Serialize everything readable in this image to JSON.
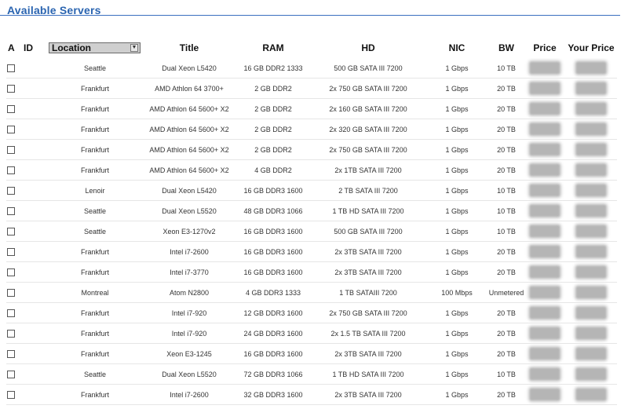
{
  "section": {
    "title": "Available Servers"
  },
  "table": {
    "headers": {
      "a": "A",
      "id": "ID",
      "location": "Location",
      "title": "Title",
      "ram": "RAM",
      "hd": "HD",
      "nic": "NIC",
      "bw": "BW",
      "price": "Price",
      "your_price": "Your Price"
    },
    "location_filter_value": "Location",
    "rows": [
      {
        "id": "",
        "location": "Seattle",
        "title": "Dual Xeon L5420",
        "ram": "16 GB DDR2 1333",
        "hd": "500 GB SATA III 7200",
        "nic": "1 Gbps",
        "bw": "10 TB"
      },
      {
        "id": "",
        "location": "Frankfurt",
        "title": "AMD Athlon 64 3700+",
        "ram": "2 GB DDR2",
        "hd": "2x 750 GB SATA III 7200",
        "nic": "1 Gbps",
        "bw": "20 TB"
      },
      {
        "id": "",
        "location": "Frankfurt",
        "title": "AMD Athlon 64 5600+ X2",
        "ram": "2 GB DDR2",
        "hd": "2x 160 GB SATA III 7200",
        "nic": "1 Gbps",
        "bw": "20 TB"
      },
      {
        "id": "",
        "location": "Frankfurt",
        "title": "AMD Athlon 64 5600+ X2",
        "ram": "2 GB DDR2",
        "hd": "2x 320 GB SATA III 7200",
        "nic": "1 Gbps",
        "bw": "20 TB"
      },
      {
        "id": "",
        "location": "Frankfurt",
        "title": "AMD Athlon 64 5600+ X2",
        "ram": "2 GB DDR2",
        "hd": "2x 750 GB SATA III 7200",
        "nic": "1 Gbps",
        "bw": "20 TB"
      },
      {
        "id": "",
        "location": "Frankfurt",
        "title": "AMD Athlon 64 5600+ X2",
        "ram": "4 GB DDR2",
        "hd": "2x 1TB SATA III 7200",
        "nic": "1 Gbps",
        "bw": "20 TB"
      },
      {
        "id": "",
        "location": "Lenoir",
        "title": "Dual Xeon L5420",
        "ram": "16 GB DDR3 1600",
        "hd": "2 TB SATA III 7200",
        "nic": "1 Gbps",
        "bw": "10 TB"
      },
      {
        "id": "",
        "location": "Seattle",
        "title": "Dual Xeon L5520",
        "ram": "48 GB DDR3 1066",
        "hd": "1 TB HD SATA III 7200",
        "nic": "1 Gbps",
        "bw": "10 TB"
      },
      {
        "id": "",
        "location": "Seattle",
        "title": "Xeon E3-1270v2",
        "ram": "16 GB DDR3 1600",
        "hd": "500 GB SATA III 7200",
        "nic": "1 Gbps",
        "bw": "10 TB"
      },
      {
        "id": "",
        "location": "Frankfurt",
        "title": "Intel i7-2600",
        "ram": "16 GB DDR3 1600",
        "hd": "2x 3TB SATA III 7200",
        "nic": "1 Gbps",
        "bw": "20 TB"
      },
      {
        "id": "",
        "location": "Frankfurt",
        "title": "Intel i7-3770",
        "ram": "16 GB DDR3 1600",
        "hd": "2x 3TB SATA III 7200",
        "nic": "1 Gbps",
        "bw": "20 TB"
      },
      {
        "id": "",
        "location": "Montreal",
        "title": "Atom N2800",
        "ram": "4 GB DDR3 1333",
        "hd": "1 TB SATAIII 7200",
        "nic": "100 Mbps",
        "bw": "Unmetered"
      },
      {
        "id": "",
        "location": "Frankfurt",
        "title": "Intel i7-920",
        "ram": "12 GB DDR3 1600",
        "hd": "2x 750 GB SATA III 7200",
        "nic": "1 Gbps",
        "bw": "20 TB"
      },
      {
        "id": "",
        "location": "Frankfurt",
        "title": "Intel i7-920",
        "ram": "24 GB DDR3 1600",
        "hd": "2x 1.5 TB SATA III 7200",
        "nic": "1 Gbps",
        "bw": "20 TB"
      },
      {
        "id": "",
        "location": "Frankfurt",
        "title": "Xeon E3-1245",
        "ram": "16 GB DDR3 1600",
        "hd": "2x 3TB SATA III 7200",
        "nic": "1 Gbps",
        "bw": "20 TB"
      },
      {
        "id": "",
        "location": "Seattle",
        "title": "Dual Xeon L5520",
        "ram": "72 GB DDR3 1066",
        "hd": "1 TB HD SATA III 7200",
        "nic": "1 Gbps",
        "bw": "10 TB"
      },
      {
        "id": "",
        "location": "Frankfurt",
        "title": "Intel i7-2600",
        "ram": "32 GB DDR3 1600",
        "hd": "2x 3TB SATA III 7200",
        "nic": "1 Gbps",
        "bw": "20 TB"
      }
    ]
  }
}
